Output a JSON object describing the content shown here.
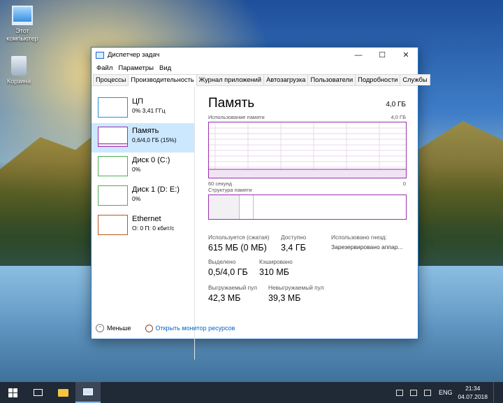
{
  "desktop": {
    "icons": [
      {
        "label": "Этот компьютер"
      },
      {
        "label": "Корзина"
      }
    ]
  },
  "window": {
    "title": "Диспетчер задач",
    "controls": {
      "minimize": "—",
      "maximize": "☐",
      "close": "✕"
    },
    "menu": [
      "Файл",
      "Параметры",
      "Вид"
    ],
    "tabs": [
      "Процессы",
      "Производительность",
      "Журнал приложений",
      "Автозагрузка",
      "Пользователи",
      "Подробности",
      "Службы"
    ],
    "active_tab": "Производительность"
  },
  "sidebar": {
    "items": [
      {
        "name": "ЦП",
        "sub": "0% 3,41 ГГц",
        "color": "#1e90d8"
      },
      {
        "name": "Память",
        "sub": "0,6/4,0 ГБ (15%)",
        "color": "#9b2fae"
      },
      {
        "name": "Диск 0 (C:)",
        "sub": "0%",
        "color": "#4caf50"
      },
      {
        "name": "Диск 1 (D: E:)",
        "sub": "0%",
        "color": "#4caf50"
      },
      {
        "name": "Ethernet",
        "sub": "О: 0 П: 0 кбит/с",
        "color": "#b85a1f"
      }
    ]
  },
  "memory": {
    "title": "Память",
    "total": "4,0 ГБ",
    "graph": {
      "label": "Использование памяти",
      "max_label": "4,0 ГБ",
      "time_label": "60 секунд",
      "zero_label": "0",
      "usage_fraction": 0.15
    },
    "structure_label": "Структура памяти",
    "stats": {
      "in_use_label": "Используется (сжатая)",
      "in_use_value": "615 МБ (0 МБ)",
      "available_label": "Доступно",
      "available_value": "3,4 ГБ",
      "slots_label": "Использовано гнезд:",
      "reserved_label": "Зарезервировано аппар...",
      "committed_label": "Выделено",
      "committed_value": "0,5/4,0 ГБ",
      "cached_label": "Кэшировано",
      "cached_value": "310 МБ",
      "paged_label": "Выгружаемый пул",
      "paged_value": "42,3 МБ",
      "nonpaged_label": "Невыгружаемый пул",
      "nonpaged_value": "39,3 МБ"
    }
  },
  "footer": {
    "less_label": "Меньше",
    "resmon_label": "Открыть монитор ресурсов"
  },
  "taskbar": {
    "lang": "ENG",
    "time": "21:34",
    "date": "04.07.2018"
  }
}
